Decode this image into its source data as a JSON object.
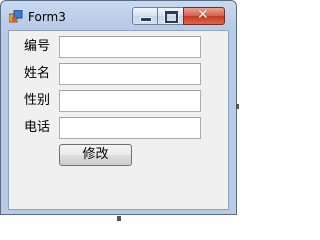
{
  "window": {
    "title": "Form3",
    "icon": "winforms-app-icon"
  },
  "titlebar_buttons": [
    "minimize-icon",
    "maximize-icon",
    "close-icon"
  ],
  "form": {
    "fields": [
      {
        "label": "编号",
        "value": ""
      },
      {
        "label": "姓名",
        "value": ""
      },
      {
        "label": "性别",
        "value": ""
      },
      {
        "label": "电话",
        "value": ""
      }
    ],
    "submit_label": "修改"
  },
  "colors": {
    "close_button": "#c9442a",
    "client_background": "#f0f0f0",
    "titlebar": "#c4d6ee"
  }
}
